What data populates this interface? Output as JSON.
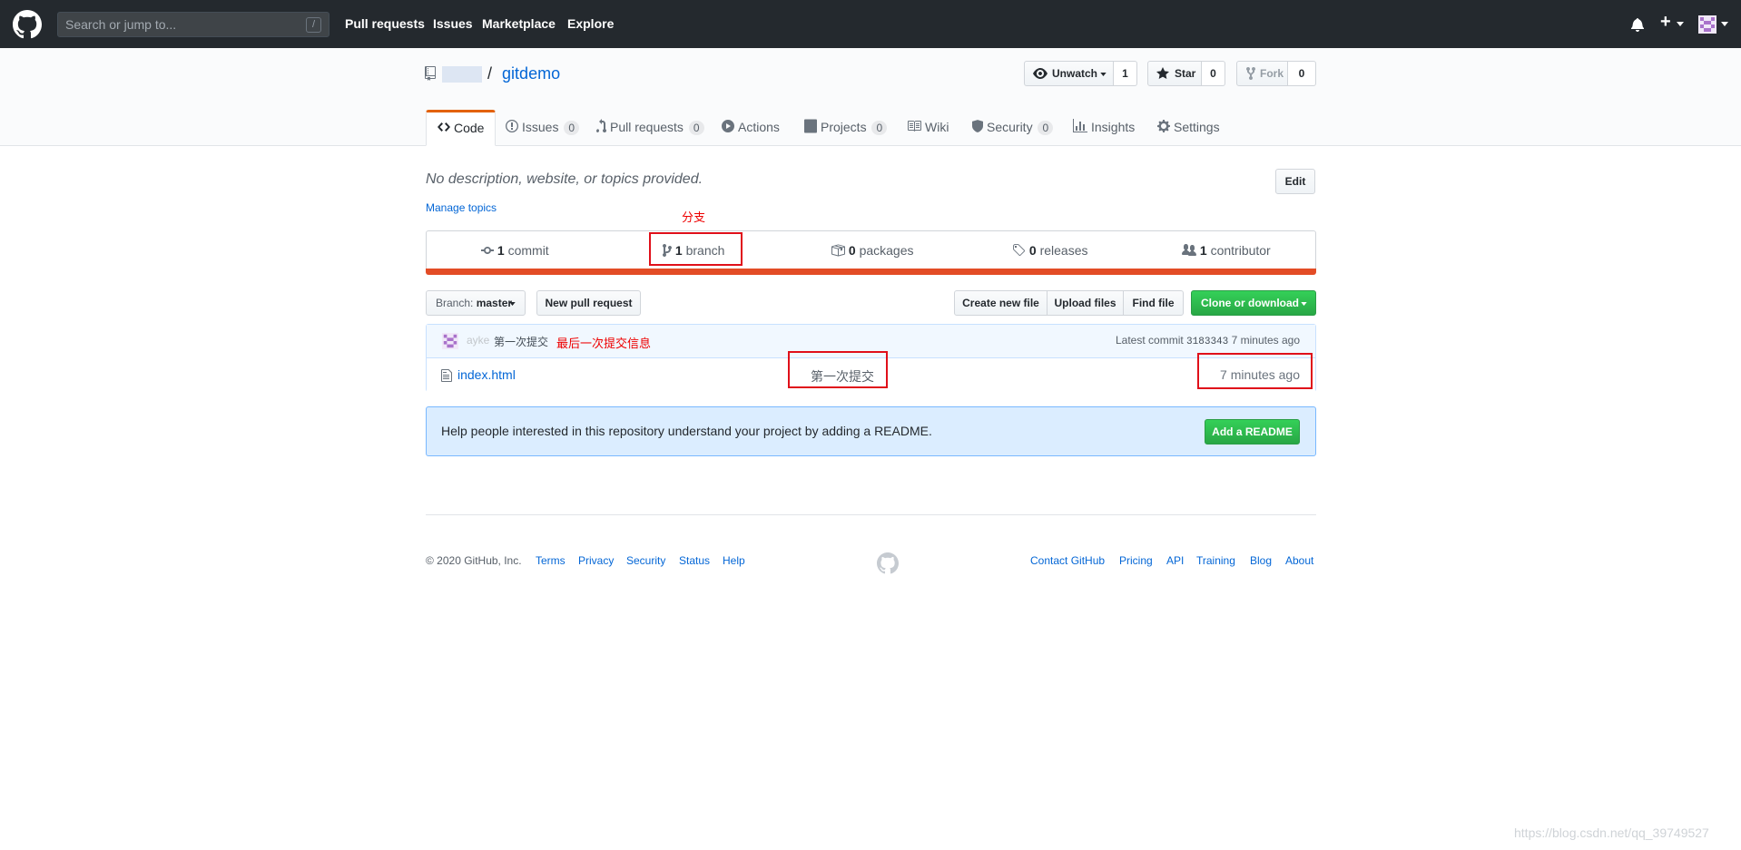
{
  "header": {
    "search_placeholder": "Search or jump to...",
    "search_shortcut": "/",
    "nav": [
      "Pull requests",
      "Issues",
      "Marketplace",
      "Explore"
    ],
    "plus_label": "+"
  },
  "repo": {
    "separator": "/",
    "name": "gitdemo",
    "watch": {
      "label": "Unwatch",
      "count": "1"
    },
    "star": {
      "label": "Star",
      "count": "0"
    },
    "fork": {
      "label": "Fork",
      "count": "0"
    }
  },
  "tabs": [
    {
      "label": "Code",
      "count": null
    },
    {
      "label": "Issues",
      "count": "0"
    },
    {
      "label": "Pull requests",
      "count": "0"
    },
    {
      "label": "Actions",
      "count": null
    },
    {
      "label": "Projects",
      "count": "0"
    },
    {
      "label": "Wiki",
      "count": null
    },
    {
      "label": "Security",
      "count": "0"
    },
    {
      "label": "Insights",
      "count": null
    },
    {
      "label": "Settings",
      "count": null
    }
  ],
  "main": {
    "description": "No description, website, or topics provided.",
    "edit_label": "Edit",
    "manage_topics": "Manage topics"
  },
  "annotations": {
    "branch": "分支",
    "last_commit": "最后一次提交信息"
  },
  "summary": {
    "commits": {
      "num": "1",
      "label": "commit"
    },
    "branches": {
      "num": "1",
      "label": "branch"
    },
    "packages": {
      "num": "0",
      "label": "packages"
    },
    "releases": {
      "num": "0",
      "label": "releases"
    },
    "contributors": {
      "num": "1",
      "label": "contributor"
    }
  },
  "toolbar": {
    "branch_prefix": "Branch:",
    "branch_name": "master",
    "new_pull_request": "New pull request",
    "create_new_file": "Create new file",
    "upload_files": "Upload files",
    "find_file": "Find file",
    "clone": "Clone or download"
  },
  "commit": {
    "author": "ayke",
    "message": "第一次提交",
    "latest_label": "Latest commit",
    "sha": "3183343",
    "age": "7 minutes ago"
  },
  "files": [
    {
      "name": "index.html",
      "message": "第一次提交",
      "age": "7 minutes ago"
    }
  ],
  "readme": {
    "text": "Help people interested in this repository understand your project by adding a README.",
    "button": "Add a README"
  },
  "footer": {
    "copyright": "© 2020 GitHub, Inc.",
    "left_links": [
      "Terms",
      "Privacy",
      "Security",
      "Status",
      "Help"
    ],
    "right_links": [
      "Contact GitHub",
      "Pricing",
      "API",
      "Training",
      "Blog",
      "About"
    ]
  },
  "watermark": "https://blog.csdn.net/qq_39749527",
  "colors": {
    "header_bg": "#24292e",
    "link": "#0366d6",
    "accent_tab": "#e36209",
    "language_bar": "#e34c26",
    "green_button": "#28a745",
    "annotation_red": "#e0101a"
  }
}
